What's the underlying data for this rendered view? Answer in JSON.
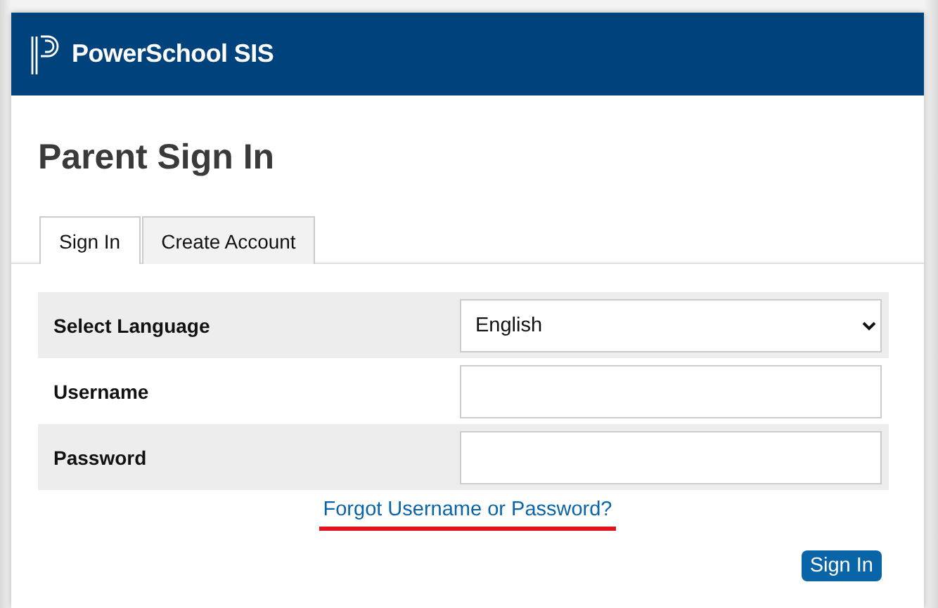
{
  "header": {
    "brand": "PowerSchool SIS"
  },
  "title": "Parent Sign In",
  "tabs": [
    {
      "label": "Sign In",
      "selected": true
    },
    {
      "label": "Create Account",
      "selected": false
    }
  ],
  "form_rows": [
    {
      "label": "Select Language",
      "kind": "select",
      "value": "English"
    },
    {
      "label": "Username",
      "kind": "input"
    },
    {
      "label": "Password",
      "kind": "input"
    }
  ],
  "forgot_link": {
    "text": "Forgot Username or Password?",
    "underlined_in_red": true
  },
  "submit_button": "Sign In"
}
